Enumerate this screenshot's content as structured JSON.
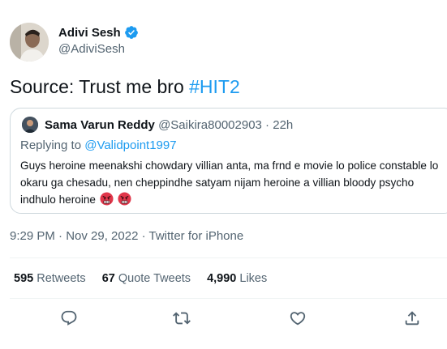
{
  "author": {
    "name": "Adivi Sesh",
    "handle": "@AdiviSesh",
    "verified_icon": "verified-badge-icon"
  },
  "tweet": {
    "text": "Source: Trust me bro ",
    "hashtag": "#HIT2"
  },
  "quoted": {
    "name": "Sama Varun Reddy",
    "handle": "@Saikira80002903",
    "separator": " · ",
    "time": "22h",
    "replying_prefix": "Replying to ",
    "replying_to": "@Validpoint1997",
    "body": "Guys heroine meenakshi chowdary villian anta, ma frnd e movie lo police constable lo okaru ga chesadu, nen cheppindhe satyam nijam heroine a villian bloody psycho indhulo heroine"
  },
  "meta": {
    "line": "9:29 PM · Nov 29, 2022 · Twitter for iPhone"
  },
  "stats": {
    "retweets_count": "595",
    "retweets_label": "Retweets",
    "quotes_count": "67",
    "quotes_label": "Quote Tweets",
    "likes_count": "4,990",
    "likes_label": "Likes"
  },
  "actions": [
    "reply-icon",
    "retweet-icon",
    "like-icon",
    "share-icon"
  ],
  "colors": {
    "accent": "#1d9bf0",
    "text": "#0f1419",
    "muted": "#536471"
  }
}
